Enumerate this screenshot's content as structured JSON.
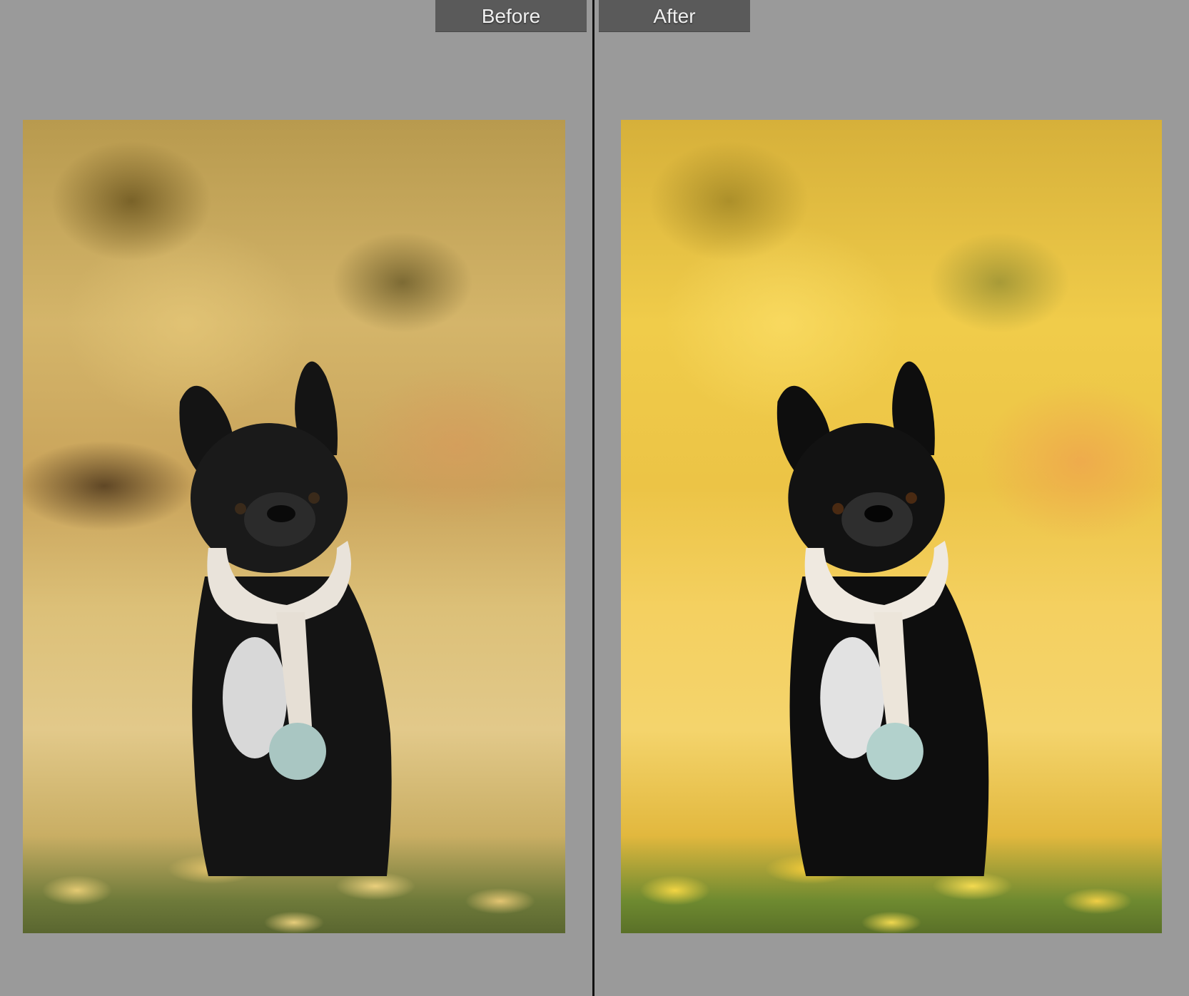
{
  "viewer": {
    "left_label": "Before",
    "right_label": "After"
  },
  "colors": {
    "background": "#9a9a9a",
    "tab": "#5a5a5a",
    "divider": "#111111"
  }
}
